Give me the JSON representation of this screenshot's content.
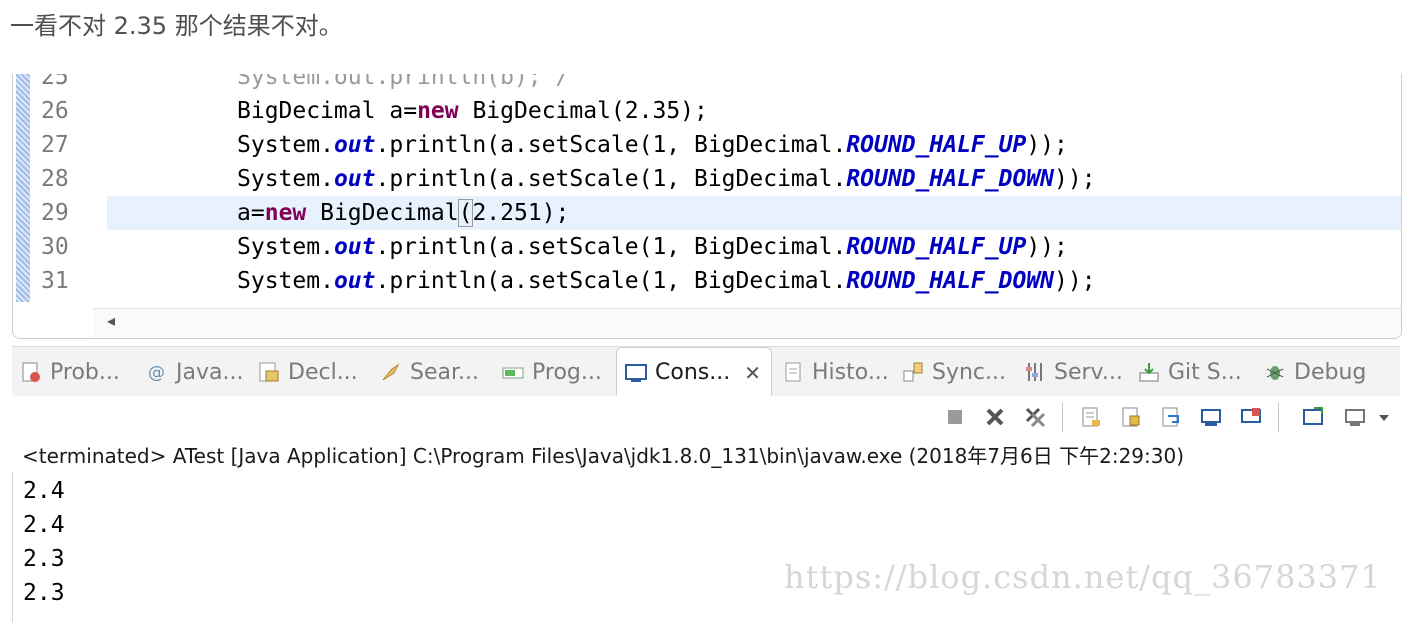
{
  "intro_text": "一看不对 2.35 那个结果不对。",
  "editor": {
    "lines": [
      {
        "num": "25",
        "text": "System.out.println(b); /"
      },
      {
        "num": "26"
      },
      {
        "num": "27"
      },
      {
        "num": "28"
      },
      {
        "num": "29"
      },
      {
        "num": "30"
      },
      {
        "num": "31"
      }
    ],
    "tokens": {
      "BigDecimal": "BigDecimal",
      "System": "System.",
      "out": "out",
      "println": ".println(",
      "a": "a",
      "eq": "=",
      "new": "new",
      "ctor1": " BigDecimal(2.35);",
      "ctor2_open": " BigDecimal",
      "paren": "(",
      "ctor2_rest": "2.251);",
      "setScale": ".setScale(1, BigDecimal.",
      "half_up": "ROUND_HALF_UP",
      "half_down": "ROUND_HALF_DOWN",
      "close": "));"
    }
  },
  "tabs": [
    {
      "label": "Prob...",
      "icon": "problems-icon"
    },
    {
      "label": "Java...",
      "icon": "javadoc-icon"
    },
    {
      "label": "Decl...",
      "icon": "declaration-icon"
    },
    {
      "label": "Sear...",
      "icon": "search-icon"
    },
    {
      "label": "Prog...",
      "icon": "progress-icon"
    },
    {
      "label": "Cons...",
      "icon": "console-icon",
      "active": true
    },
    {
      "label": "Histo...",
      "icon": "history-icon"
    },
    {
      "label": "Sync...",
      "icon": "synchronize-icon"
    },
    {
      "label": "Serv...",
      "icon": "servers-icon"
    },
    {
      "label": "Git S...",
      "icon": "git-staging-icon"
    },
    {
      "label": "Debug",
      "icon": "debug-icon"
    }
  ],
  "console": {
    "status": "<terminated> ATest [Java Application] C:\\Program Files\\Java\\jdk1.8.0_131\\bin\\javaw.exe (2018年7月6日 下午2:29:30)",
    "output": [
      "2.4",
      "2.4",
      "2.3",
      "2.3"
    ]
  },
  "watermark": "https://blog.csdn.net/qq_36783371",
  "close_glyph": "✕",
  "scroll_left_glyph": "◂"
}
